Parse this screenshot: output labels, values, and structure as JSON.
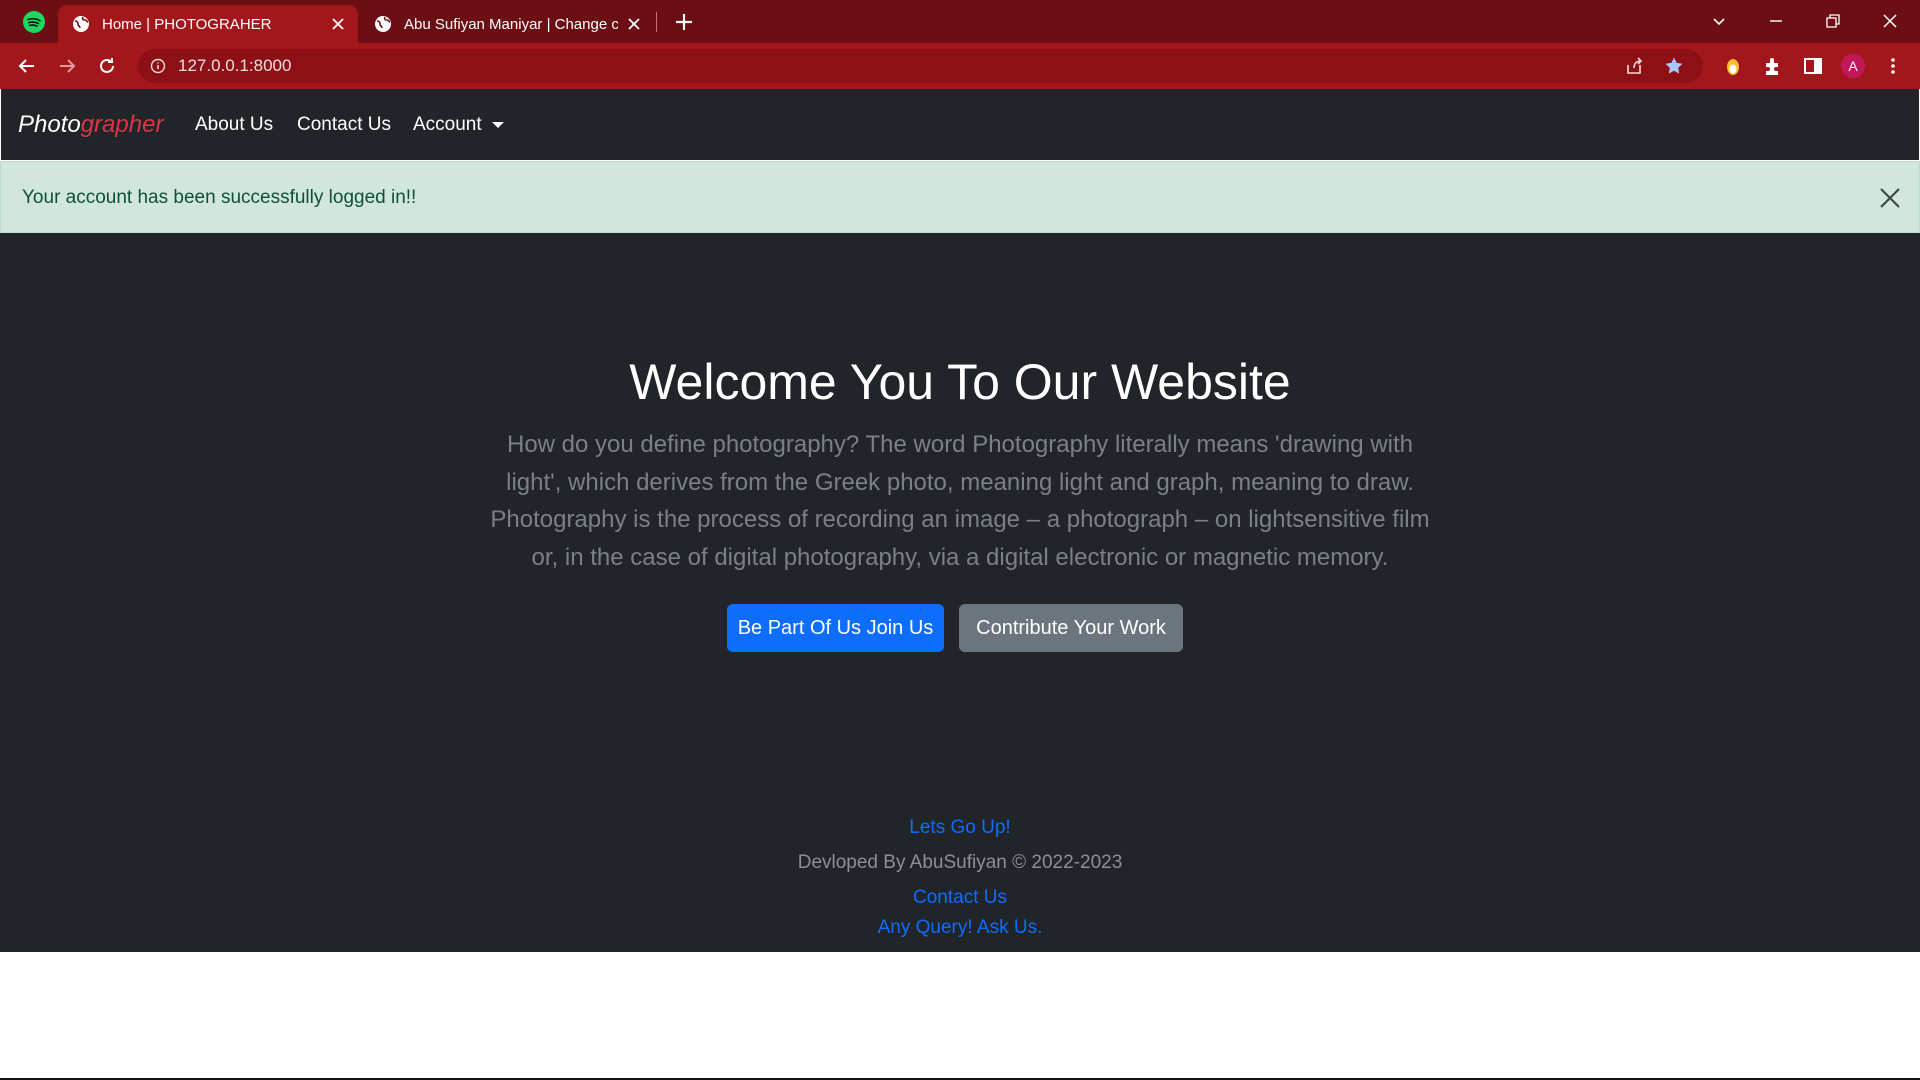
{
  "browser": {
    "tabs": [
      {
        "title": "Home | PHOTOGRAHER",
        "active": true
      },
      {
        "title": "Abu Sufiyan Maniyar | Change co",
        "active": false
      }
    ],
    "url": "127.0.0.1:8000",
    "profile_initial": "A",
    "colors": {
      "tabstrip": "#6b0f14",
      "toolbar": "#a3161c"
    }
  },
  "navbar": {
    "brand_part1": "Photo",
    "brand_part2": "grapher",
    "links": [
      "About Us",
      "Contact Us",
      "Account"
    ]
  },
  "alert": {
    "message": "Your account has been successfully logged in!!"
  },
  "hero": {
    "title": "Welcome You To Our Website",
    "lines": [
      "How do you define photography? The word Photography literally means 'drawing with",
      "light', which derives from the Greek photo, meaning light and graph, meaning to draw.",
      "Photography is the process of recording an image – a photograph – on lightsensitive film",
      "or, in the case of digital photography, via a digital electronic or magnetic memory."
    ],
    "primary_button": "Be Part Of Us Join Us",
    "secondary_button": "Contribute Your Work"
  },
  "footer": {
    "top_link": "Lets Go Up!",
    "credit": "Devloped By AbuSufiyan © 2022-2023",
    "contact_link": "Contact Us",
    "query_link": "Any Query! Ask Us."
  },
  "colors": {
    "page_bg": "#212529",
    "brand_accent": "#dc3545",
    "primary": "#0d6efd",
    "secondary": "#6c757d",
    "alert_bg": "#d1e7dd"
  }
}
